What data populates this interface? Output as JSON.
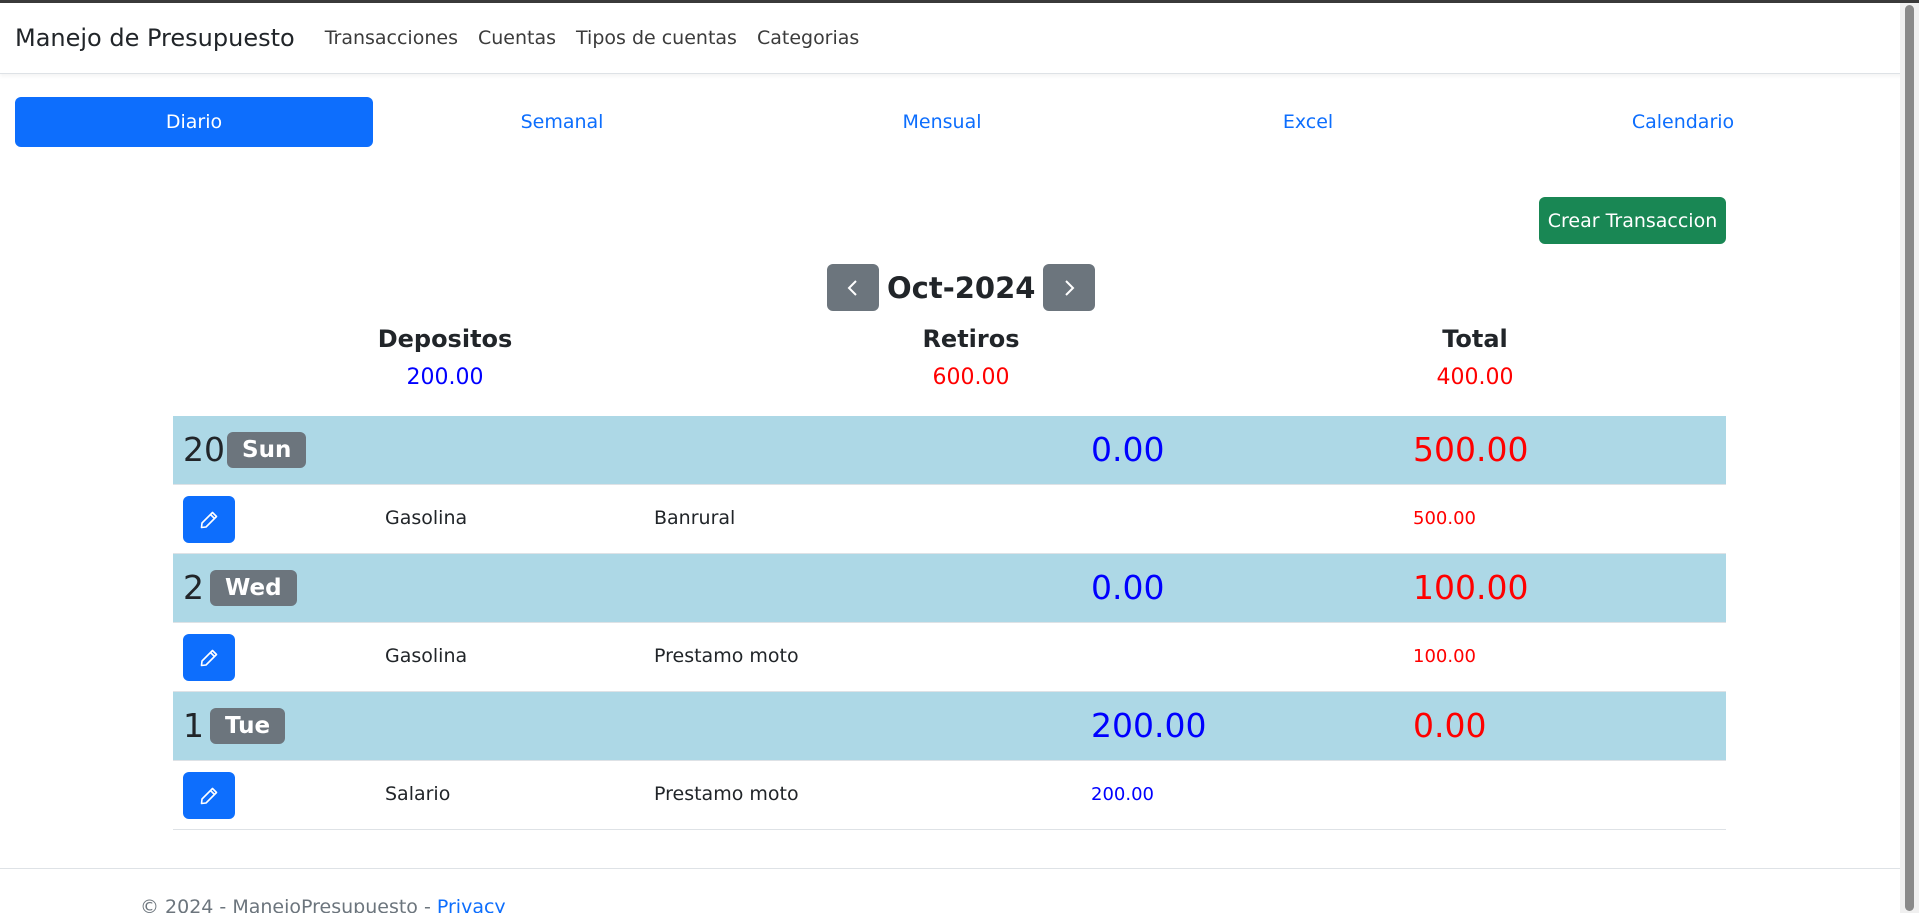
{
  "navbar": {
    "brand": "Manejo de Presupuesto",
    "links": [
      "Transacciones",
      "Cuentas",
      "Tipos de cuentas",
      "Categorias"
    ]
  },
  "tabs": [
    "Diario",
    "Semanal",
    "Mensual",
    "Excel",
    "Calendario"
  ],
  "active_tab": "Diario",
  "create_button": "Crear Transaccion",
  "month": "Oct-2024",
  "summary": {
    "depositos_label": "Depositos",
    "depositos_value": "200.00",
    "retiros_label": "Retiros",
    "retiros_value": "600.00",
    "total_label": "Total",
    "total_value": "400.00"
  },
  "days": [
    {
      "day": "20",
      "weekday": "Sun",
      "depositos": "0.00",
      "retiros": "500.00",
      "transactions": [
        {
          "category": "Gasolina",
          "account": "Banrural",
          "deposito": "",
          "retiro": "500.00"
        }
      ]
    },
    {
      "day": "2",
      "weekday": "Wed",
      "depositos": "0.00",
      "retiros": "100.00",
      "transactions": [
        {
          "category": "Gasolina",
          "account": "Prestamo moto",
          "deposito": "",
          "retiro": "100.00"
        }
      ]
    },
    {
      "day": "1",
      "weekday": "Tue",
      "depositos": "200.00",
      "retiros": "0.00",
      "transactions": [
        {
          "category": "Salario",
          "account": "Prestamo moto",
          "deposito": "200.00",
          "retiro": ""
        }
      ]
    }
  ],
  "footer": {
    "text": "© 2024 - ManejoPresupuesto - ",
    "link": "Privacy"
  },
  "colors": {
    "primary": "#0d6efd",
    "success": "#198754",
    "secondary": "#6c757d",
    "day_row_bg": "#add8e6",
    "deposit": "#0000ff",
    "withdrawal": "#ff0000"
  }
}
